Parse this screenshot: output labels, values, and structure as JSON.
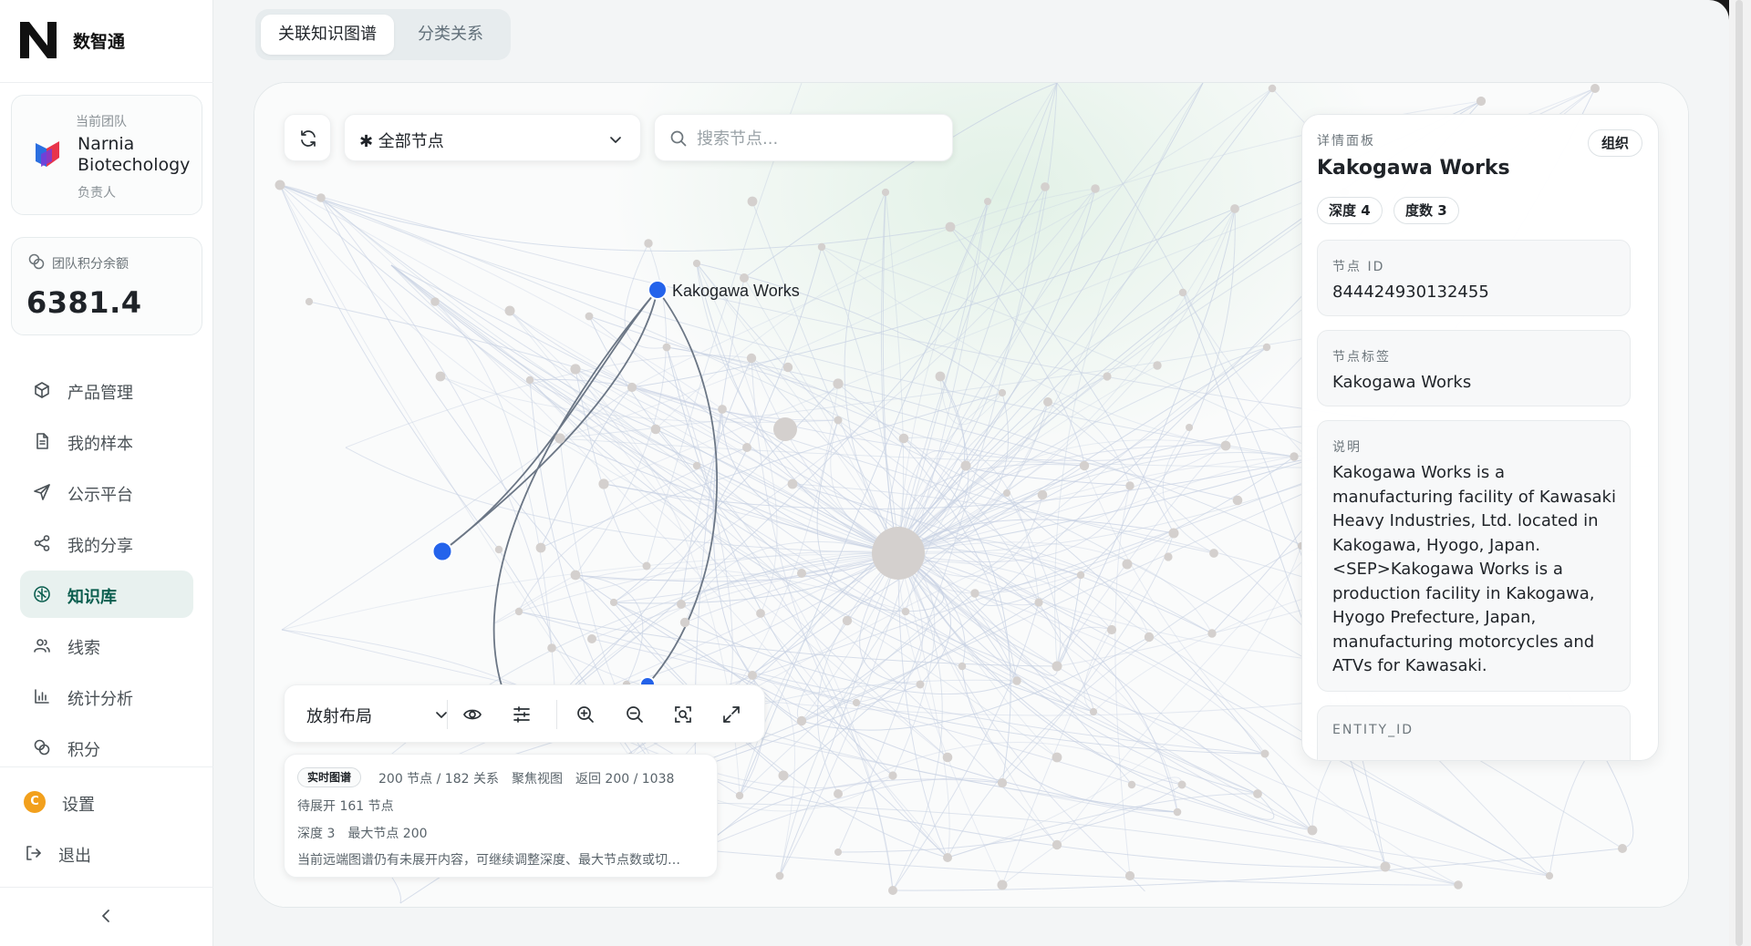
{
  "brand": {
    "name": "数智通"
  },
  "team": {
    "caption": "当前团队",
    "name": "Narnia Biotechology",
    "role": "负责人"
  },
  "credits": {
    "caption": "团队积分余额",
    "value": "6381.4"
  },
  "nav": [
    {
      "label": "产品管理",
      "icon": "cube-icon",
      "active": false
    },
    {
      "label": "我的样本",
      "icon": "document-icon",
      "active": false
    },
    {
      "label": "公示平台",
      "icon": "send-icon",
      "active": false
    },
    {
      "label": "我的分享",
      "icon": "share-icon",
      "active": false
    },
    {
      "label": "知识库",
      "icon": "brain-icon",
      "active": true
    },
    {
      "label": "线索",
      "icon": "users-icon",
      "active": false
    },
    {
      "label": "统计分析",
      "icon": "bar-chart-icon",
      "active": false
    },
    {
      "label": "积分",
      "icon": "coins-icon",
      "active": false
    }
  ],
  "footer": {
    "settings": "设置",
    "settings_badge": "C",
    "logout": "退出"
  },
  "tabs": [
    {
      "label": "关联知识图谱",
      "active": true
    },
    {
      "label": "分类关系",
      "active": false
    }
  ],
  "controls": {
    "filter_value": "✱ 全部节点",
    "search_placeholder": "搜索节点..."
  },
  "graph": {
    "focus_label": "Kakogawa Works",
    "colors": {
      "focus": "#2463eb",
      "node": "#d4d0ce",
      "edge": "#c6d0e2",
      "focus_edge": "#6b7685"
    }
  },
  "toolbar": {
    "layout": "放射布局"
  },
  "info": {
    "badge": "实时图谱",
    "stats": "200 节点 / 182 关系　聚焦视图　返回 200 / 1038",
    "pending": "待展开 161 节点",
    "depth": "深度 3　最大节点 200",
    "note": "当前远端图谱仍有未展开内容，可继续调整深度、最大节点数或切…"
  },
  "detail": {
    "caption": "详情面板",
    "type": "组织",
    "title": "Kakogawa Works",
    "depth_chip": "深度 4",
    "degree_chip": "度数 3",
    "id_label": "节点 ID",
    "id_value": "844424930132455",
    "tag_label": "节点标签",
    "tag_value": "Kakogawa Works",
    "desc_label": "说明",
    "desc_value": "Kakogawa Works is a manufacturing facility of Kawasaki Heavy Industries, Ltd. located in Kakogawa, Hyogo, Japan. <SEP>Kakogawa Works is a production facility in Kakogawa, Hyogo Prefecture, Japan, manufacturing motorcycles and ATVs for Kawasaki.",
    "entity_label": "ENTITY_ID"
  }
}
